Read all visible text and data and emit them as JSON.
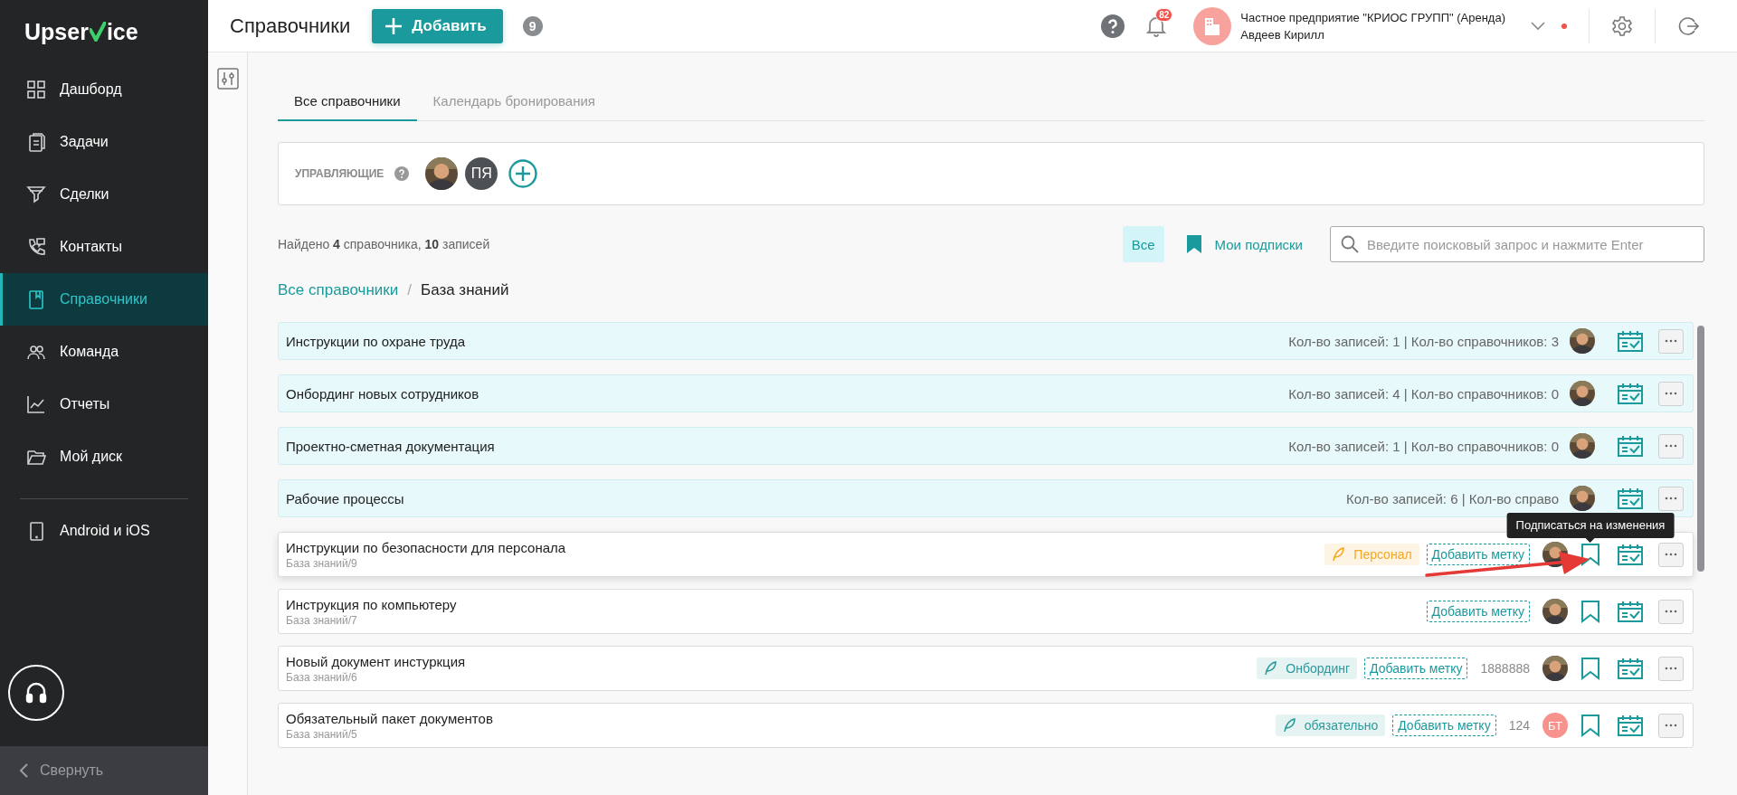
{
  "sidebar": {
    "logo_start": "Upser",
    "logo_end": "ice",
    "nav": [
      {
        "label": "Дашборд",
        "selected": false
      },
      {
        "label": "Задачи",
        "selected": false
      },
      {
        "label": "Сделки",
        "selected": false
      },
      {
        "label": "Контакты",
        "selected": false
      },
      {
        "label": "Справочники",
        "selected": true
      },
      {
        "label": "Команда",
        "selected": false
      },
      {
        "label": "Отчеты",
        "selected": false
      },
      {
        "label": "Мой диск",
        "selected": false
      }
    ],
    "apps_link": "Android и iOS",
    "collapse": "Свернуть"
  },
  "header": {
    "title": "Справочники",
    "add_button": "Добавить",
    "count_badge": "9",
    "notifications": "82",
    "account": {
      "org": "Частное предприятие \"КРИОС ГРУПП\" (Аренда)",
      "user": "Авдеев Кирилл",
      "alert": true
    }
  },
  "tabs": [
    {
      "label": "Все справочники",
      "selected": true
    },
    {
      "label": "Календарь бронирования",
      "selected": false
    }
  ],
  "managers": {
    "label": "УПРАВЛЯЮЩИЕ",
    "people": [
      {
        "kind": "photo"
      },
      {
        "kind": "initials",
        "initials": "ПЯ",
        "color": "#4d5055"
      }
    ]
  },
  "summary": "Найдено **4** справочника, **10** записей",
  "filters": [
    {
      "label": "Все",
      "selected": true
    },
    {
      "label": "Мои подписки",
      "selected": false
    }
  ],
  "search": {
    "placeholder": "Введите поисковый запрос и нажмите Enter"
  },
  "breadcrumb": {
    "items": [
      "Все справочники",
      "База знаний"
    ],
    "separator": "/"
  },
  "folders": [
    {
      "name": "Инструкции по охране труда",
      "stats": "Кол-во записей: 1 | Кол-во справочников: 3"
    },
    {
      "name": "Онбординг новых сотрудников",
      "stats": "Кол-во записей: 4 | Кол-во справочников: 0"
    },
    {
      "name": "Проектно-сметная документация",
      "stats": "Кол-во записей: 1 | Кол-во справочников: 0"
    },
    {
      "name": "Рабочие процессы",
      "stats": "Кол-во записей: 6 | Кол-во справо"
    }
  ],
  "documents": [
    {
      "title": "Инструкции по безопасности для персонала",
      "path": "База знаний/9",
      "tag": {
        "label": "Персонал",
        "color": "#f5a623"
      },
      "add_tag": "Добавить метку",
      "owner": {
        "kind": "photo"
      },
      "tooltip": "Подписаться на изменения",
      "annotated": true
    },
    {
      "title": "Инструкция по компьютеру",
      "path": "База знаний/7",
      "add_tag": "Добавить метку",
      "owner": {
        "kind": "photo"
      },
      "annotated": false
    },
    {
      "title": "Новый документ инстуркция",
      "path": "База знаний/6",
      "tag": {
        "label": "Онбординг",
        "color": "#2a9a9c"
      },
      "add_tag": "Добавить метку",
      "number": "1888888",
      "owner": {
        "kind": "photo"
      },
      "annotated": false
    },
    {
      "title": "Обязательный пакет документов",
      "path": "База знаний/5",
      "tag": {
        "label": "обязательно",
        "color": "#2a9a9c"
      },
      "add_tag": "Добавить метку",
      "number": "124",
      "owner": {
        "kind": "initials",
        "initials": "БТ",
        "color": "#f7928c"
      },
      "annotated": false
    }
  ]
}
